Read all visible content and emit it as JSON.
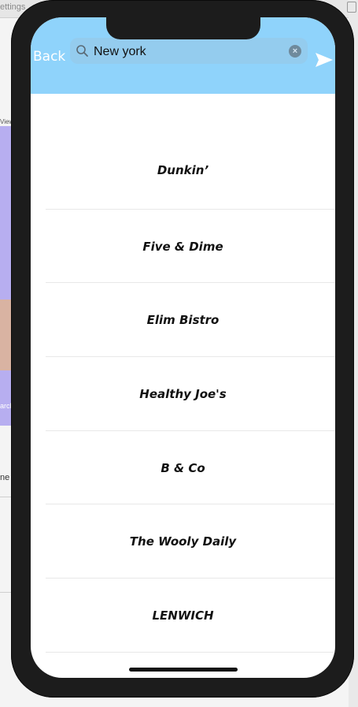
{
  "background": {
    "top_text": "ettings",
    "left_label_a": "View C",
    "left_label_b": "arch",
    "left_text": "ne"
  },
  "navbar": {
    "back_label": "Back",
    "color": "#8fd3fb"
  },
  "search": {
    "value": "New york",
    "placeholder": ""
  },
  "restaurants": [
    {
      "name": "Dunkin’"
    },
    {
      "name": "Five & Dime"
    },
    {
      "name": "Elim Bistro"
    },
    {
      "name": "Healthy Joe's"
    },
    {
      "name": "B & Co"
    },
    {
      "name": "The Wooly Daily"
    },
    {
      "name": "LENWICH"
    }
  ],
  "icons": {
    "search": "search-icon",
    "clear": "clear-icon",
    "send": "send-icon"
  }
}
